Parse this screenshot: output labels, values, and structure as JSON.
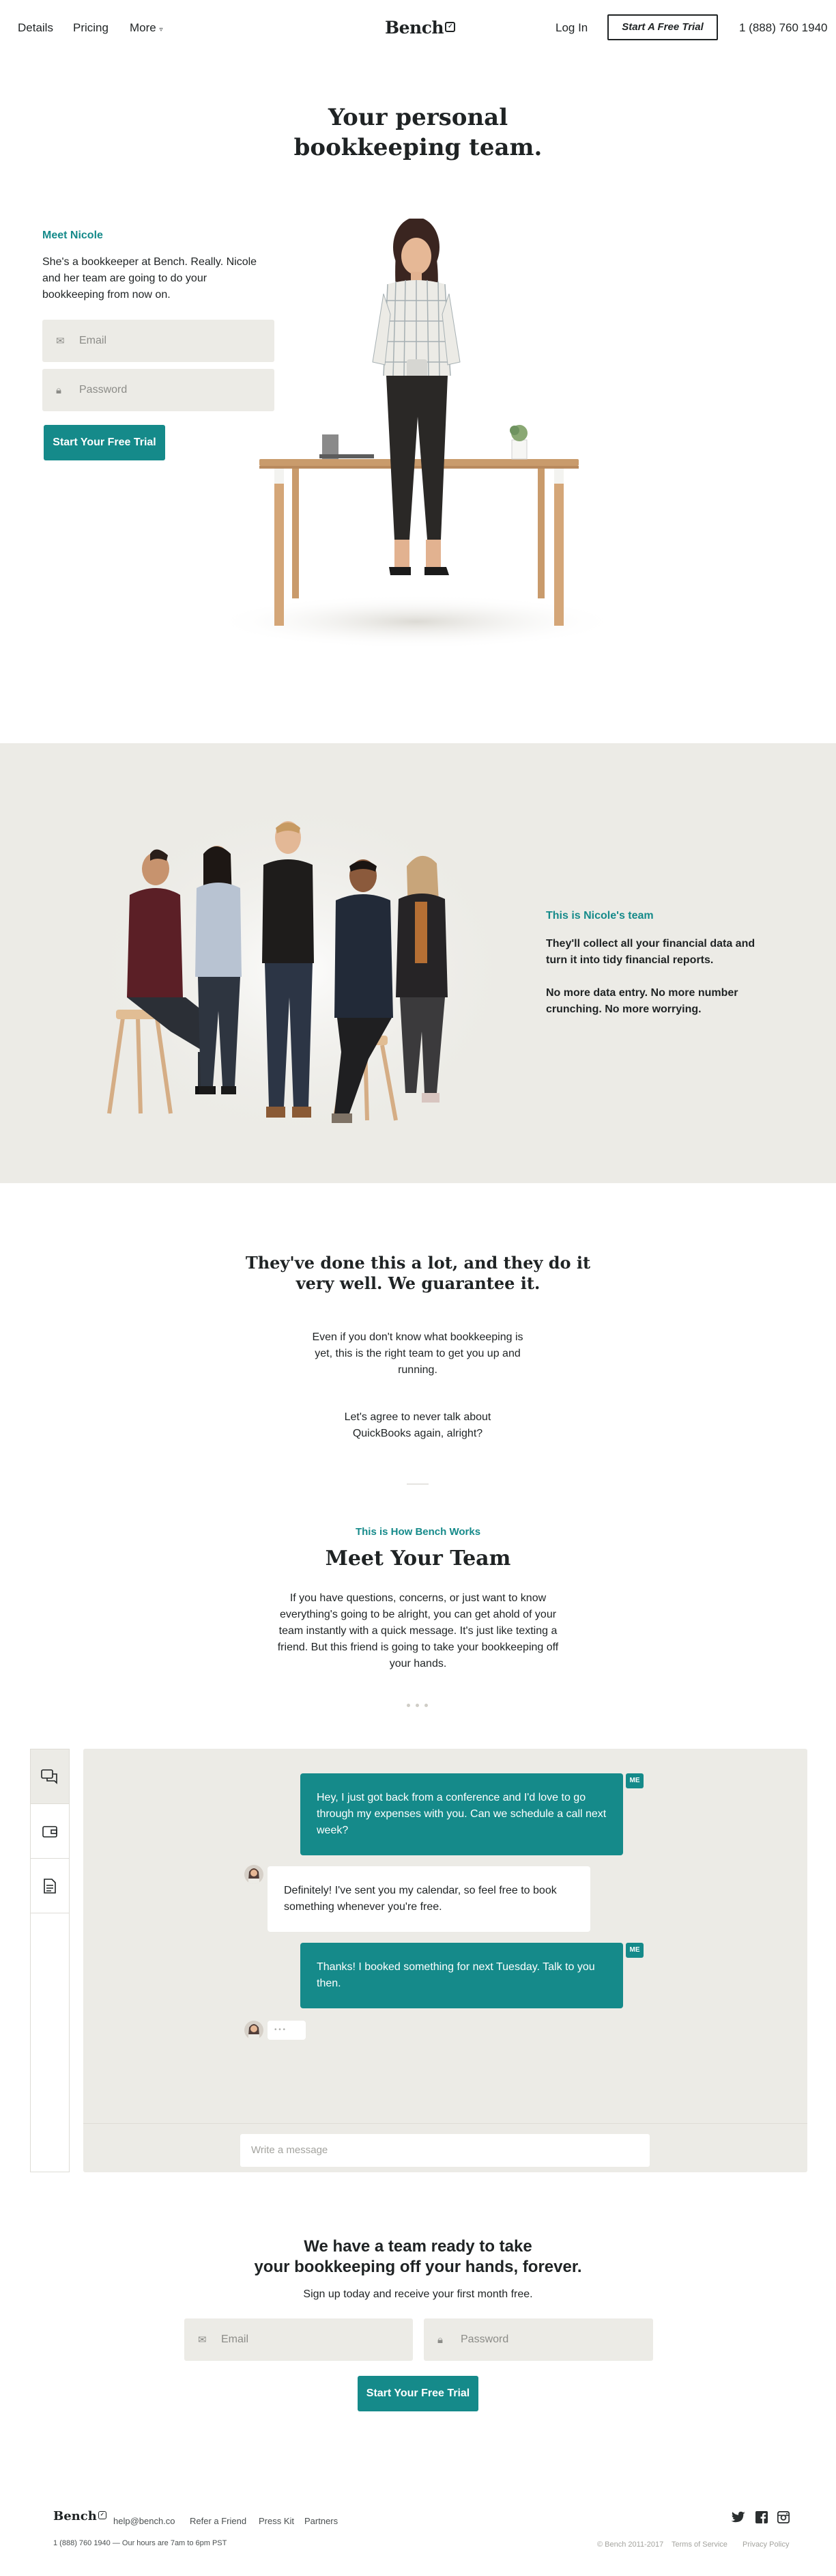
{
  "nav": {
    "details": "Details",
    "pricing": "Pricing",
    "more": "More",
    "logo": "Bench",
    "login": "Log In",
    "trial": "Start A Free Trial",
    "phone": "1 (888) 760 1940"
  },
  "hero": {
    "title_line1": "Your personal",
    "title_line2": "bookkeeping team.",
    "meet": "Meet Nicole",
    "desc": "She's a bookkeeper at Bench. Really. Nicole and her team are going to do your bookkeeping from now on.",
    "email_placeholder": "Email",
    "password_placeholder": "Password",
    "cta": "Start Your Free Trial"
  },
  "team": {
    "label": "This is Nicole's team",
    "p1": "They'll collect all your financial data and turn it into tidy financial reports.",
    "p2": "No more data entry. No more number crunching. No more worrying."
  },
  "guarantee": {
    "title_line1": "They've done this a lot, and they do it",
    "title_line2": "very well. We guarantee it.",
    "p1": "Even if you don't know what bookkeeping is yet, this is the right team to get you up and running.",
    "p2": "Let's agree to never talk about QuickBooks again, alright?"
  },
  "how": {
    "label": "This is How Bench Works",
    "title": "Meet Your Team",
    "desc": "If you have questions, concerns, or just want to know everything's going to be alright, you can get ahold of your team instantly with a quick message. It's just like texting a friend. But this friend is going to take your bookkeeping off your hands."
  },
  "chat": {
    "me_tag": "ME",
    "msg1": "Hey, I just got back from a conference and I'd love to go through my expenses with you. Can we schedule a call next week?",
    "msg2": "Definitely! I've sent you my calendar, so feel free to book something whenever you're free.",
    "msg3": "Thanks! I booked something for next Tuesday. Talk to you then.",
    "typing": "• • •",
    "input_placeholder": "Write a message"
  },
  "signup": {
    "title_line1": "We have a team ready to take",
    "title_line2": "your bookkeeping off your hands, forever.",
    "sub": "Sign up today and receive your first month free.",
    "email_placeholder": "Email",
    "password_placeholder": "Password",
    "cta": "Start Your Free Trial"
  },
  "footer": {
    "logo": "Bench",
    "email": "help@bench.co",
    "refer": "Refer a Friend",
    "press": "Press Kit",
    "partners": "Partners",
    "hours": "1 (888) 760 1940 — Our hours are 7am to 6pm PST",
    "copyright": "© Bench 2011-2017",
    "terms": "Terms of Service",
    "privacy": "Privacy Policy"
  },
  "colors": {
    "accent": "#158a8a",
    "sand": "#ecebe6",
    "text": "#1f2324"
  }
}
